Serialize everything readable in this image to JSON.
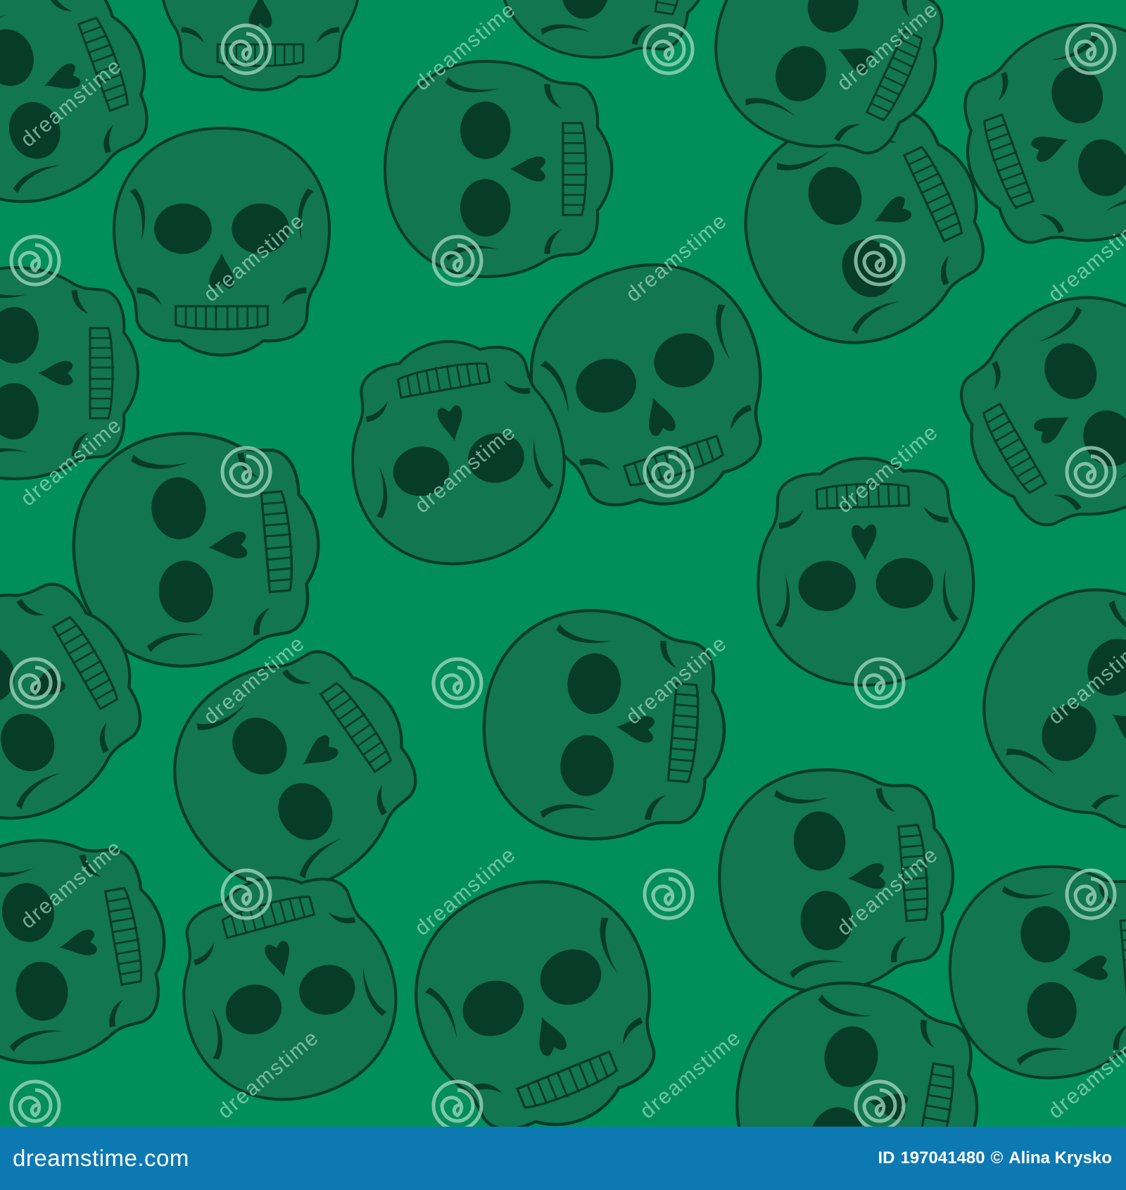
{
  "colors": {
    "background": "#008f5a",
    "skull_fill": "#127650",
    "skull_dark": "#063c28",
    "outline": "#063c28",
    "watermark": "#a7d9c4",
    "footer_bar": "#0d79b2",
    "footer_text": "#ffffff"
  },
  "pattern": {
    "motif": "skull",
    "watermark_icon": "swirl-icon",
    "watermark_text": "dreamstime"
  },
  "footer": {
    "logo_text": "dreamstime.com",
    "id_label": "ID",
    "id_number": "197041480",
    "copyright": "©",
    "author": "Alina Krysko"
  }
}
